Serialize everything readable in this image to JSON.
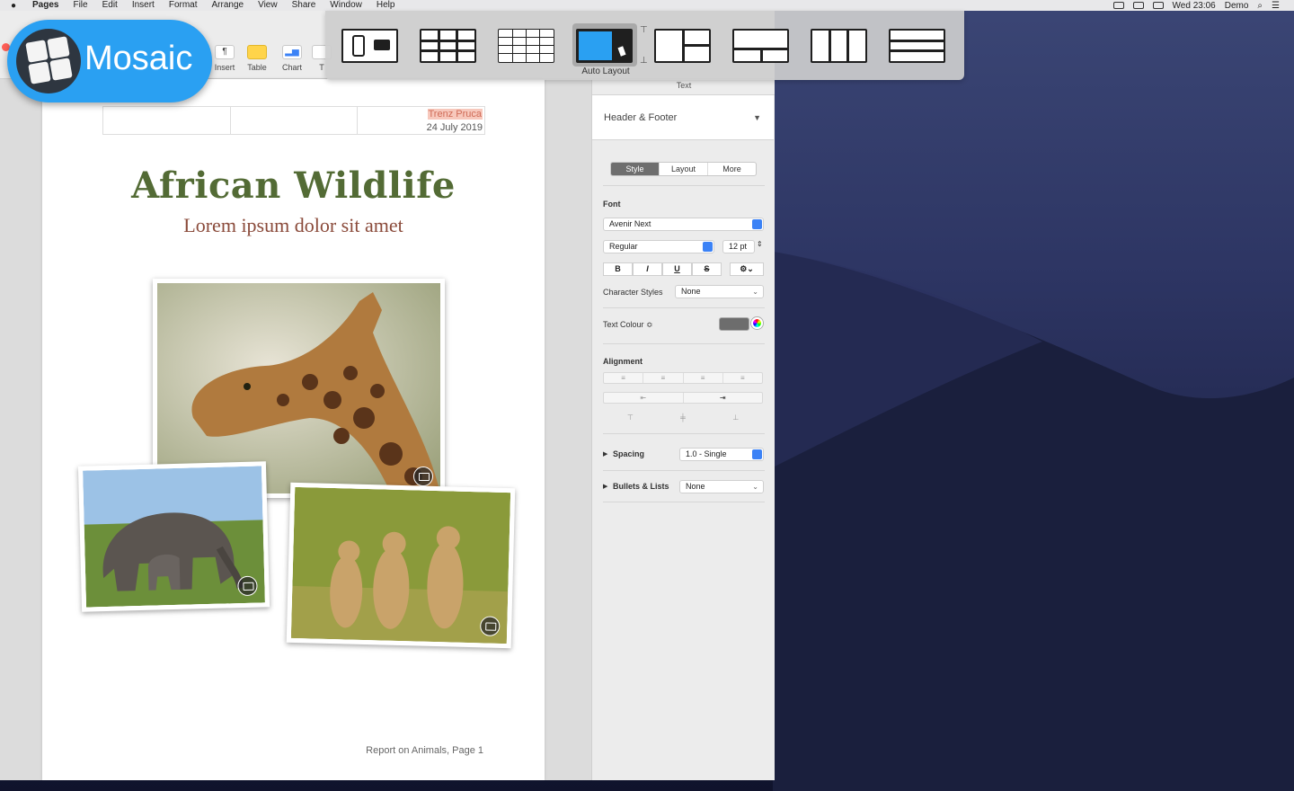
{
  "menubar": {
    "items": [
      "Pages",
      "File",
      "Edit",
      "Insert",
      "Format",
      "Arrange",
      "View",
      "Share",
      "Window",
      "Help"
    ],
    "clock": "Wed 23:06",
    "user": "Demo"
  },
  "toolbar": {
    "insert_label": "Insert",
    "table_label": "Table",
    "chart_label": "Chart",
    "text_label": "T",
    "para_label": "¶"
  },
  "mosaic": {
    "app_name": "Mosaic",
    "auto_layout_label": "Auto Layout",
    "tick_top": "⊤",
    "tick_bottom": "⊥"
  },
  "document": {
    "author": "Trenz Pruca",
    "date": "24 July 2019",
    "title": "African Wildlife",
    "subtitle": "Lorem ipsum dolor sit amet",
    "footer": "Report on Animals, Page 1"
  },
  "inspector": {
    "tab_label": "Text",
    "paragraph_style": "Header & Footer",
    "tabs": [
      "Style",
      "Layout",
      "More"
    ],
    "font_label": "Font",
    "font_family": "Avenir Next",
    "font_style": "Regular",
    "font_size": "12 pt",
    "format_buttons": [
      "B",
      "I",
      "U",
      "S",
      "⚙⌄"
    ],
    "character_styles_label": "Character Styles",
    "character_styles_value": "None",
    "text_colour_label": "Text Colour ≎",
    "alignment_label": "Alignment",
    "spacing_label": "Spacing",
    "spacing_value": "1.0 - Single",
    "bullets_label": "Bullets & Lists",
    "bullets_value": "None"
  },
  "colors": {
    "title_green": "#536b35",
    "subtitle_brown": "#8a4a3a",
    "mosaic_blue": "#2aa0f2",
    "accent_blue": "#3b82f6"
  }
}
